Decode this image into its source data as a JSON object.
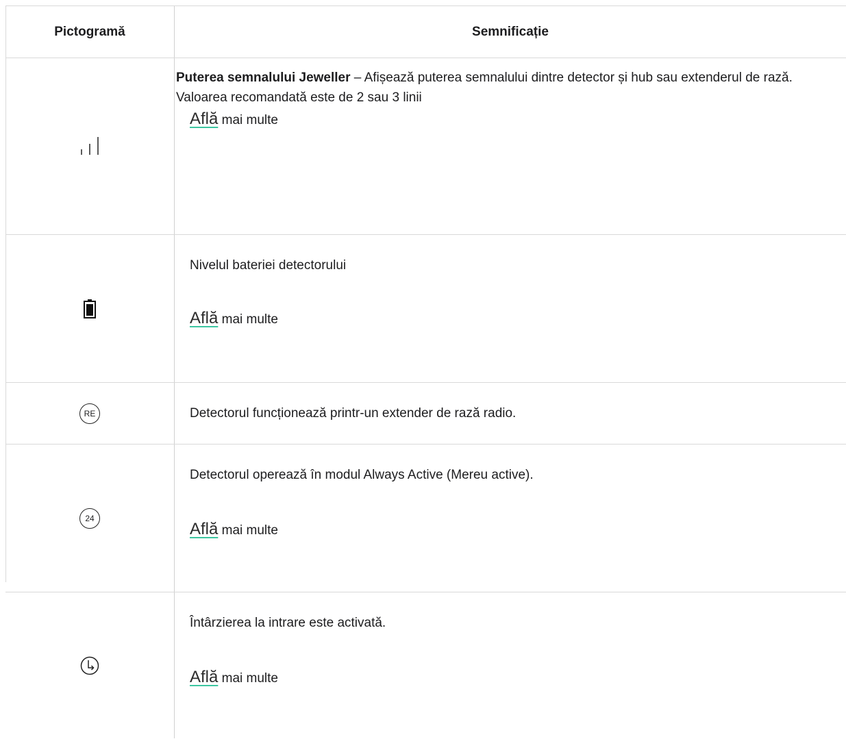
{
  "header": {
    "col_icon": "Pictogramă",
    "col_meaning": "Semnificație"
  },
  "rows": [
    {
      "icon": "signal-strength-icon",
      "title": "Puterea semnalului Jeweller",
      "text": " – Afișează puterea semnalului dintre detector și hub sau extenderul de rază. Valoarea recomandată este de 2 sau 3 linii",
      "link": "Află",
      "more": " mai multe"
    },
    {
      "icon": "battery-icon",
      "text": "Nivelul bateriei detectorului",
      "link": "Află",
      "more": " mai multe"
    },
    {
      "icon": "re-circle-icon",
      "icon_text": "RE",
      "text": "Detectorul funcționează printr-un extender de rază radio."
    },
    {
      "icon": "24-circle-icon",
      "icon_text": "24",
      "text": "Detectorul operează în modul Always Active (Mereu active).",
      "link": "Află",
      "more": " mai multe"
    },
    {
      "icon": "clock-entry-delay-icon",
      "text": "Întârzierea la intrare este activată.",
      "link": "Află",
      "more": " mai multe"
    }
  ]
}
